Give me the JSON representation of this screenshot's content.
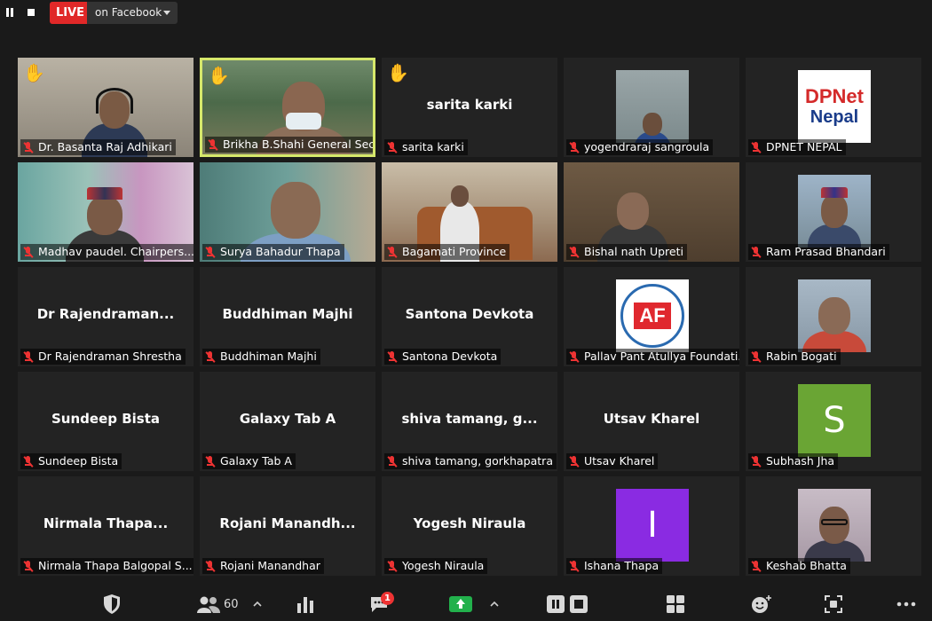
{
  "colors": {
    "live_red": "#e02828",
    "mic_off_red": "#e33333",
    "active_speaker_border": "#d6e86b",
    "share_green": "#22b14c",
    "hand_yellow": "#f5b400"
  },
  "top_bar": {
    "pause_icon": "pause-icon",
    "stop_icon": "stop-icon",
    "live_label": "LIVE",
    "live_destination": "on Facebook"
  },
  "participants": [
    {
      "name": "Dr. Basanta Raj Adhikari",
      "video": true,
      "hand_raised": true,
      "active": false
    },
    {
      "name": "Brikha B.Shahi General Secreta...",
      "video": true,
      "hand_raised": true,
      "active": true
    },
    {
      "name": "sarita karki",
      "display_name": "sarita karki",
      "video": false,
      "hand_raised": true,
      "active": false
    },
    {
      "name": "yogendraraj sangroula",
      "video": true,
      "hand_raised": false,
      "active": false
    },
    {
      "name": "DPNET NEPAL",
      "video": true,
      "hand_raised": false,
      "active": false,
      "logo_text_line1": "DPNet",
      "logo_text_line2": "Nepal"
    },
    {
      "name": "Madhav paudel. Chairpers...",
      "video": true,
      "hand_raised": false,
      "active": false
    },
    {
      "name": "Surya Bahadur Thapa",
      "video": true,
      "hand_raised": false,
      "active": false
    },
    {
      "name": "Bagamati Province",
      "video": true,
      "hand_raised": false,
      "active": false
    },
    {
      "name": "Bishal nath Upreti",
      "video": true,
      "hand_raised": false,
      "active": false
    },
    {
      "name": "Ram Prasad Bhandari",
      "video": true,
      "hand_raised": false,
      "active": false
    },
    {
      "name": "Dr Rajendraman Shrestha",
      "display_name": "Dr  Rajendraman...",
      "video": false,
      "hand_raised": false,
      "active": false
    },
    {
      "name": "Buddhiman Majhi",
      "display_name": "Buddhiman Majhi",
      "video": false,
      "hand_raised": false,
      "active": false
    },
    {
      "name": "Santona Devkota",
      "display_name": "Santona Devkota",
      "video": false,
      "hand_raised": false,
      "active": false
    },
    {
      "name": "Pallav Pant Atullya Foundati...",
      "video": true,
      "hand_raised": false,
      "active": false,
      "logo_text": "AF"
    },
    {
      "name": "Rabin Bogati",
      "video": true,
      "hand_raised": false,
      "active": false
    },
    {
      "name": "Sundeep Bista",
      "display_name": "Sundeep Bista",
      "video": false,
      "hand_raised": false,
      "active": false
    },
    {
      "name": "Galaxy Tab A",
      "display_name": "Galaxy Tab A",
      "video": false,
      "hand_raised": false,
      "active": false
    },
    {
      "name": "shiva tamang, gorkhapatra",
      "display_name": "shiva  tamang,  g...",
      "video": false,
      "hand_raised": false,
      "active": false
    },
    {
      "name": "Utsav Kharel",
      "display_name": "Utsav Kharel",
      "video": false,
      "hand_raised": false,
      "active": false
    },
    {
      "name": "Subhash Jha",
      "video": false,
      "hand_raised": false,
      "active": false,
      "avatar_letter": "S",
      "avatar_color": "#6aa534"
    },
    {
      "name": "Nirmala Thapa Balgopal S...",
      "display_name": "Nirmala  Thapa...",
      "video": false,
      "hand_raised": false,
      "active": false
    },
    {
      "name": "Rojani Manandhar",
      "display_name": "Rojani  Manandh...",
      "video": false,
      "hand_raised": false,
      "active": false
    },
    {
      "name": "Yogesh Niraula",
      "display_name": "Yogesh Niraula",
      "video": false,
      "hand_raised": false,
      "active": false
    },
    {
      "name": "Ishana Thapa",
      "video": false,
      "hand_raised": false,
      "active": false,
      "avatar_letter": "I",
      "avatar_color": "#8a2be2"
    },
    {
      "name": "Keshab Bhatta",
      "video": true,
      "hand_raised": false,
      "active": false
    }
  ],
  "bottom_bar": {
    "security_icon": "shield-icon",
    "participants_count": "60",
    "participants_icon": "people-icon",
    "polls_icon": "bar-chart-icon",
    "chat_icon": "chat-icon",
    "chat_badge": "1",
    "share_icon": "share-screen-icon",
    "pause_share_icon": "pause-icon",
    "stop_share_icon": "stop-icon",
    "apps_icon": "grid-icon",
    "reactions_icon": "emoji-icon",
    "layout_icon": "layout-icon",
    "more_icon": "more-icon"
  }
}
